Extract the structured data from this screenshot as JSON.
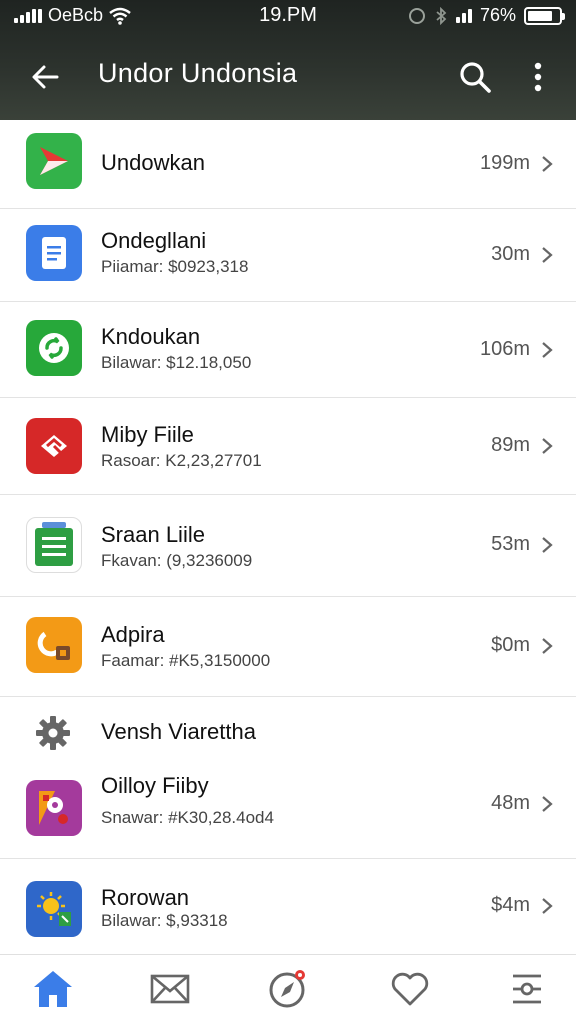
{
  "status_bar": {
    "carrier": "OeBcb",
    "time": "19.PM",
    "battery": "76%"
  },
  "app_bar": {
    "title": "Undor Undonsia"
  },
  "items": [
    {
      "name": "Undowkan",
      "sub": "",
      "size": "199m",
      "icon": "play-arrow-icon",
      "color": "#33b24a"
    },
    {
      "name": "Ondegllani",
      "sub": "Piiamar: $0923,318",
      "size": "30m",
      "icon": "document-icon",
      "color": "#3b7de8"
    },
    {
      "name": "Kndoukan",
      "sub": "Bilawar: $12.18,050",
      "size": "106m",
      "icon": "sync-icon",
      "color": "#27a83a"
    },
    {
      "name": "Miby Fiile",
      "sub": "Rasoar: K2,23,27701",
      "size": "89m",
      "icon": "pen-icon",
      "color": "#d62828"
    },
    {
      "name": "Sraan Liile",
      "sub": "Fkavan: (9,3236009",
      "size": "53m",
      "icon": "list-icon",
      "color": "#2e9e43"
    },
    {
      "name": "Adpira",
      "sub": "Faamar: #K5,3150000",
      "size": "$0m",
      "icon": "tools-icon",
      "color": "#f39a16"
    }
  ],
  "section": {
    "label": "Vensh Viarettha",
    "icon": "gear-icon"
  },
  "items2": [
    {
      "name": "Oilloy Fiiby",
      "sub": "Snawar: #K30,28.4od4",
      "size": "48m",
      "icon": "photo-icon",
      "color": "#a43a9c"
    },
    {
      "name": "Rorowan",
      "sub": "Bilawar: $,93318",
      "size": "$4m",
      "icon": "weather-icon",
      "color": "#2f67c9"
    }
  ],
  "bottom_nav": [
    {
      "name": "home",
      "icon": "home-icon",
      "active": true
    },
    {
      "name": "mail",
      "icon": "mail-icon",
      "active": false
    },
    {
      "name": "compass",
      "icon": "compass-icon",
      "active": false
    },
    {
      "name": "favorites",
      "icon": "heart-icon",
      "active": false
    },
    {
      "name": "settings",
      "icon": "sliders-icon",
      "active": false
    }
  ],
  "colors": {
    "topbar": "#2c322d",
    "accent": "#3b7de8",
    "divider": "#e3e3e3"
  }
}
